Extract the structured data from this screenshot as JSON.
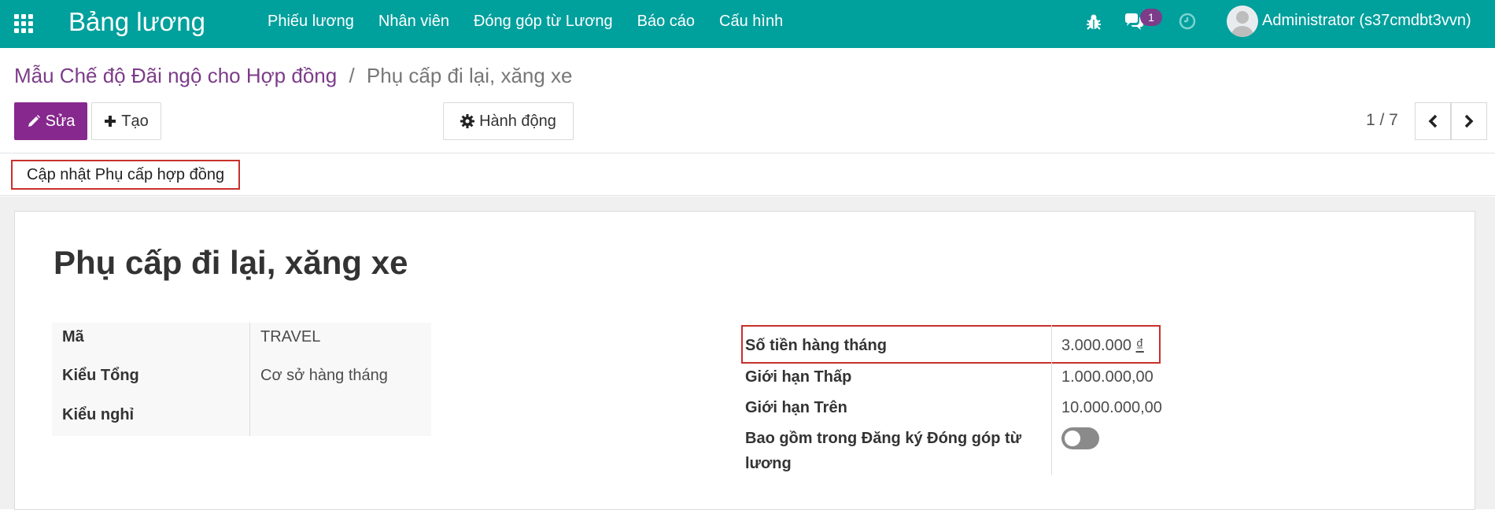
{
  "navbar": {
    "brand": "Bảng lương",
    "menu": [
      "Phiếu lương",
      "Nhân viên",
      "Đóng góp từ Lương",
      "Báo cáo",
      "Cấu hình"
    ],
    "message_count": "1",
    "user": "Administrator (s37cmdbt3vvn)",
    "icons": [
      "apps-icon",
      "bug-icon",
      "chat-icon",
      "clock-icon",
      "avatar"
    ]
  },
  "breadcrumb": {
    "parent": "Mẫu Chế độ Đãi ngộ cho Hợp đồng",
    "separator": "/",
    "current": "Phụ cấp đi lại, xăng xe"
  },
  "toolbar": {
    "edit_label": "Sửa",
    "create_label": "Tạo",
    "action_label": "Hành động",
    "pager": "1 / 7"
  },
  "statusbar": {
    "update_label": "Cập nhật Phụ cấp hợp đồng"
  },
  "form": {
    "title": "Phụ cấp đi lại, xăng xe",
    "left": {
      "code_label": "Mã",
      "code_value": "TRAVEL",
      "total_type_label": "Kiểu Tổng",
      "total_type_value": "Cơ sở hàng tháng",
      "leave_type_label": "Kiểu nghỉ",
      "leave_type_value": ""
    },
    "right": {
      "monthly_label": "Số tiền hàng tháng",
      "monthly_value": "3.000.000",
      "monthly_currency": "₫",
      "lower_label": "Giới hạn Thấp",
      "lower_value": "1.000.000,00",
      "upper_label": "Giới hạn Trên",
      "upper_value": "10.000.000,00",
      "include_label_1": "Bao gồm trong Đăng ký Đóng góp từ",
      "include_label_2": "lương",
      "include_value": false
    }
  },
  "colors": {
    "navbar": "#00a09d",
    "primary": "#87288e",
    "link": "#7c3c89",
    "highlight": "#c9302c"
  }
}
